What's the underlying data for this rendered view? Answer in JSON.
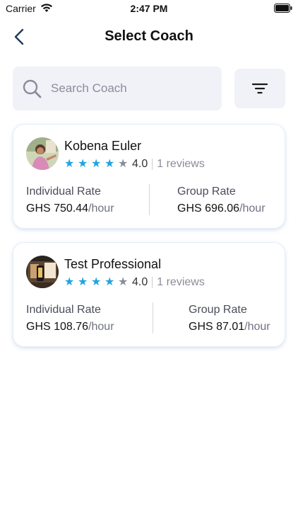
{
  "status_bar": {
    "carrier": "Carrier",
    "time": "2:47 PM"
  },
  "header": {
    "title": "Select Coach"
  },
  "search": {
    "placeholder": "Search Coach",
    "value": ""
  },
  "colors": {
    "star_filled": "#1fa3e0",
    "star_empty": "#8a8c99",
    "card_border": "#e8eef6",
    "search_bg": "#f1f2f8"
  },
  "coaches": [
    {
      "name": "Kobena Euler",
      "stars_filled": 4,
      "rating": "4.0",
      "reviews": "1 reviews",
      "individual_label": "Individual Rate",
      "individual_amount": "GHS 750.44",
      "group_label": "Group Rate",
      "group_amount": "GHS 696.06",
      "unit": "/hour"
    },
    {
      "name": "Test Professional",
      "stars_filled": 4,
      "rating": "4.0",
      "reviews": "1 reviews",
      "individual_label": "Individual Rate",
      "individual_amount": "GHS 108.76",
      "group_label": "Group Rate",
      "group_amount": "GHS 87.01",
      "unit": "/hour"
    }
  ]
}
